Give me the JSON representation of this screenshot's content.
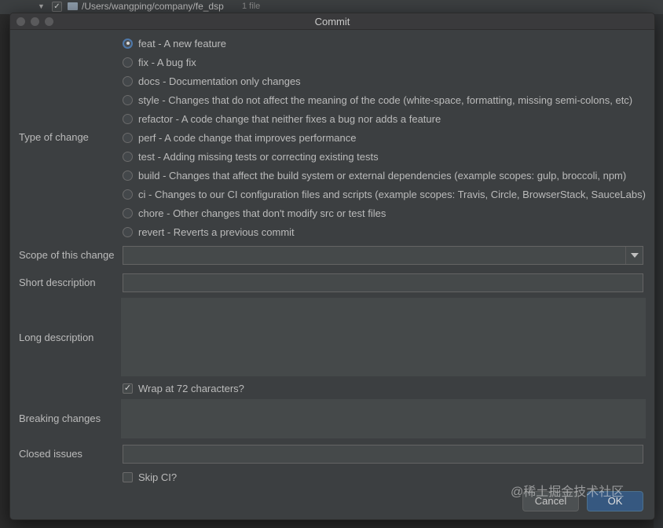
{
  "background": {
    "tree_path": "/Users/wangping/company/fe_dsp",
    "tree_count": "1 file",
    "checkbox_glyph": "✓"
  },
  "dialog": {
    "title": "Commit",
    "type_label": "Type of change",
    "types": [
      {
        "label": "feat - A new feature",
        "selected": true
      },
      {
        "label": "fix - A bug fix",
        "selected": false
      },
      {
        "label": "docs - Documentation only changes",
        "selected": false
      },
      {
        "label": "style - Changes that do not affect the meaning of the code (white-space, formatting, missing semi-colons, etc)",
        "selected": false
      },
      {
        "label": "refactor - A code change that neither fixes a bug nor adds a feature",
        "selected": false
      },
      {
        "label": "perf - A code change that improves performance",
        "selected": false
      },
      {
        "label": "test - Adding missing tests or correcting existing tests",
        "selected": false
      },
      {
        "label": "build - Changes that affect the build system or external dependencies (example scopes: gulp, broccoli, npm)",
        "selected": false
      },
      {
        "label": "ci - Changes to our CI configuration files and scripts (example scopes: Travis, Circle, BrowserStack, SauceLabs)",
        "selected": false
      },
      {
        "label": "chore - Other changes that don't modify src or test files",
        "selected": false
      },
      {
        "label": "revert - Reverts a previous commit",
        "selected": false
      }
    ],
    "scope_label": "Scope of this change",
    "scope_value": "",
    "short_label": "Short description",
    "short_value": "",
    "long_label": "Long description",
    "long_value": "",
    "wrap_label": "Wrap at 72 characters?",
    "wrap_checked": true,
    "wrap_glyph": "✓",
    "breaking_label": "Breaking changes",
    "breaking_value": "",
    "closed_label": "Closed issues",
    "closed_value": "",
    "skipci_label": "Skip CI?",
    "skipci_checked": false,
    "cancel_label": "Cancel",
    "ok_label": "OK"
  },
  "watermark": "@稀土掘金技术社区",
  "colors": {
    "dialog_bg": "#3c3f41",
    "field_bg": "#45494a",
    "accent": "#4e78a9",
    "text": "#bbbbbb"
  }
}
